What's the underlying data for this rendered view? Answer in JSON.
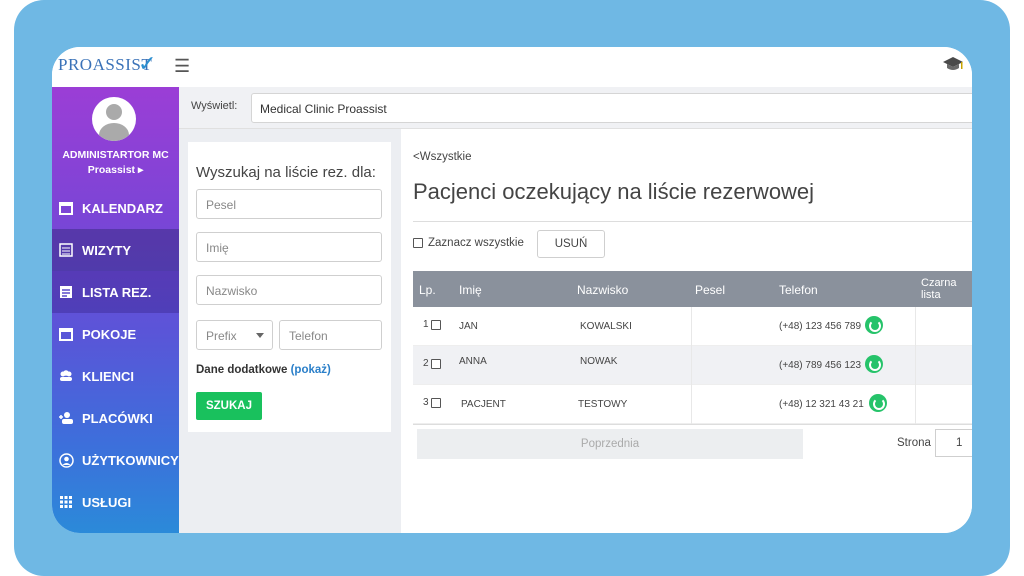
{
  "app": {
    "logo_text": "PROASSIST"
  },
  "display": {
    "label": "Wyświetl:",
    "value": "Medical Clinic Proassist"
  },
  "user": {
    "name": "ADMINISTARTOR MC",
    "clinic": "Proassist ▸"
  },
  "sidebar": {
    "items": [
      {
        "label": "KALENDARZ",
        "icon": "calendar-icon"
      },
      {
        "label": "WIZYTY",
        "icon": "list-icon"
      },
      {
        "label": "LISTA REZ.",
        "icon": "document-icon"
      },
      {
        "label": "POKOJE",
        "icon": "calendar-icon"
      },
      {
        "label": "KLIENCI",
        "icon": "users-icon"
      },
      {
        "label": "PLACÓWKI",
        "icon": "person-add-icon"
      },
      {
        "label": "UŻYTKOWNICY",
        "icon": "user-circle-icon"
      },
      {
        "label": "USŁUGI",
        "icon": "grid-icon"
      }
    ]
  },
  "search": {
    "title": "Wyszukaj na liście rez. dla:",
    "pesel_placeholder": "Pesel",
    "first_name_placeholder": "Imię",
    "last_name_placeholder": "Nazwisko",
    "prefix_placeholder": "Prefix",
    "phone_placeholder": "Telefon",
    "extra_label": "Dane dodatkowe",
    "extra_link": "(pokaż)",
    "button": "SZUKAJ"
  },
  "main": {
    "back": "<Wszystkie",
    "title": "Pacjenci oczekujący na liście rezerwowej",
    "select_all": "Zaznacz wszystkie",
    "delete_button": "USUŃ"
  },
  "table": {
    "headers": {
      "lp": "Lp.",
      "first": "Imię",
      "last": "Nazwisko",
      "pesel": "Pesel",
      "phone": "Telefon",
      "blacklist_1": "Czarna",
      "blacklist_2": "lista"
    },
    "rows": [
      {
        "lp": "1",
        "first": "JAN",
        "last": "KOWALSKI",
        "pesel": "",
        "phone": "(+48) 123 456 789"
      },
      {
        "lp": "2",
        "first": "ANNA",
        "last": "NOWAK",
        "pesel": "",
        "phone": "(+48) 789 456 123"
      },
      {
        "lp": "3",
        "first": "PACJENT",
        "last": "TESTOWY",
        "pesel": "",
        "phone": "(+48) 12 321 43 21"
      }
    ]
  },
  "pager": {
    "prev": "Poprzednia",
    "page_label": "Strona",
    "page": "1"
  },
  "colors": {
    "accent_green": "#19c15d",
    "whatsapp": "#26c36a",
    "header_gray": "#8a919c",
    "frame_blue": "#6fb8e4"
  }
}
